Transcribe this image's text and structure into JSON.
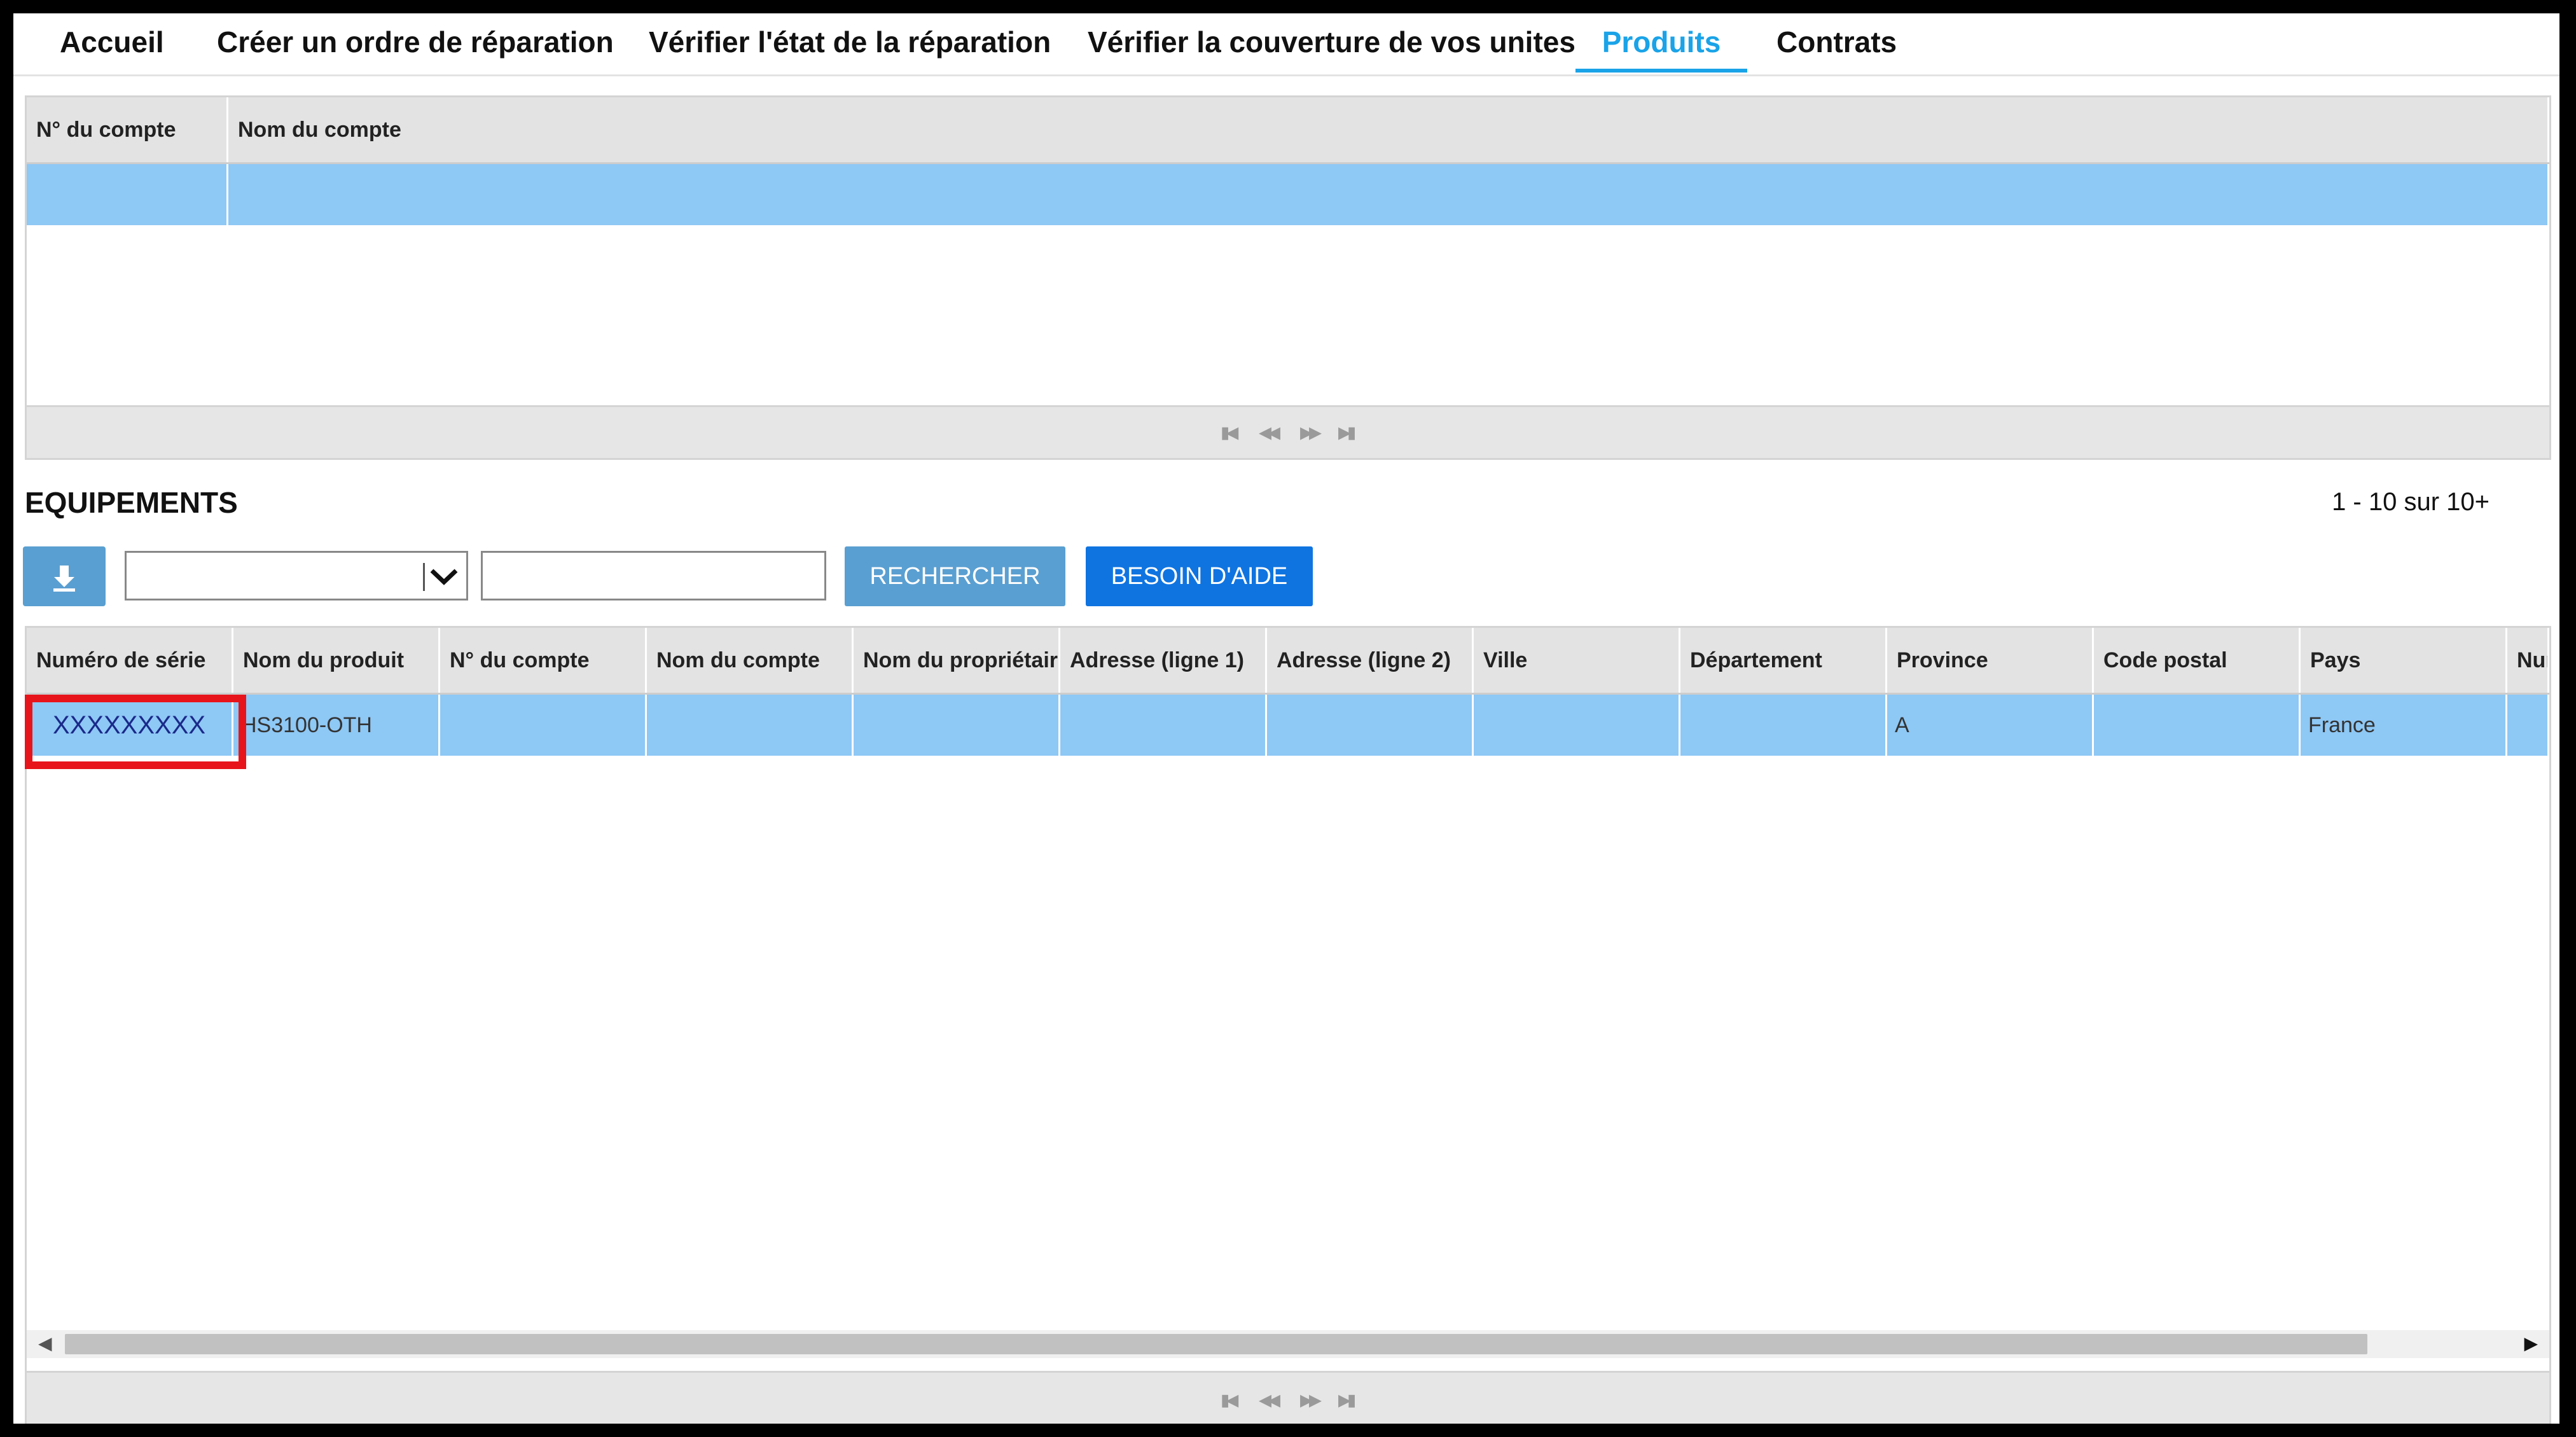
{
  "nav": {
    "tabs": [
      {
        "label": "Accueil",
        "active": false
      },
      {
        "label": "Créer un ordre de réparation",
        "active": false
      },
      {
        "label": "Vérifier l'état de la réparation",
        "active": false
      },
      {
        "label": "Vérifier la couverture de vos unites",
        "active": false
      },
      {
        "label": "Produits",
        "active": true
      },
      {
        "label": "Contrats",
        "active": false
      }
    ]
  },
  "accounts_grid": {
    "columns": [
      "N° du compte",
      "Nom du compte"
    ],
    "selected_row": [
      "",
      ""
    ],
    "pager_icons": [
      "first-page-icon",
      "prev-page-icon",
      "next-page-icon",
      "last-page-icon"
    ]
  },
  "equipments": {
    "title": "EQUIPEMENTS",
    "count_text": "1 - 10 sur 10+",
    "filter_select_value": "",
    "search_value": "",
    "search_button": "RECHERCHER",
    "help_button": "BESOIN D'AIDE",
    "download_icon": "download-icon",
    "columns": [
      "Numéro de série",
      "Nom du produit",
      "N° du compte",
      "Nom du compte",
      "Nom du propriétaire",
      "Adresse (ligne 1)",
      "Adresse (ligne 2)",
      "Ville",
      "Département",
      "Province",
      "Code postal",
      "Pays",
      "Num"
    ],
    "rows": [
      [
        "XXXXXXXXX",
        "HS3100-OTH",
        "",
        "",
        "",
        "",
        "",
        "",
        "",
        "A",
        "",
        "France",
        ""
      ]
    ]
  },
  "colors": {
    "accent_tab": "#1aa3e8",
    "selected_row": "#8ec8f5",
    "button_primary": "#0f74e0",
    "button_secondary": "#5a9fd1",
    "highlight_box": "#e8141b"
  }
}
